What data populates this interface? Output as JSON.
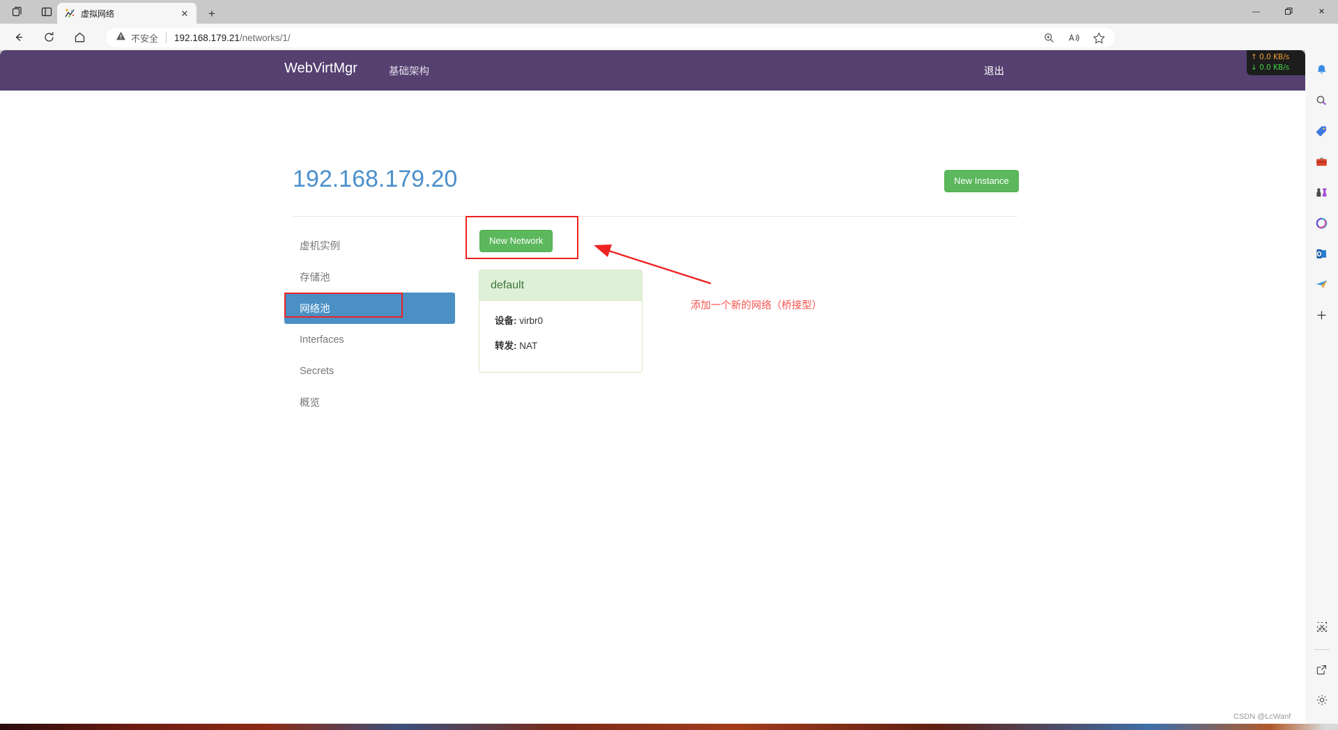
{
  "browser": {
    "tab": {
      "title": "虚拟网络",
      "favicon": "chart-icon",
      "close": "✕"
    },
    "newtab_label": "+",
    "window_controls": {
      "minimize": "—",
      "maximize": "❐",
      "close": "✕"
    },
    "toolbar_left_icons": [
      "tab-groups-icon",
      "split-screen-icon"
    ],
    "nav": {
      "back": "←",
      "refresh": "⟳",
      "home": "⌂"
    },
    "omnibox": {
      "security_label": "不安全",
      "security_icon": "warning-triangle-icon",
      "url_host": "192.168.179.21",
      "url_path": "/networks/1/",
      "actions": [
        "zoom-icon",
        "read-aloud-icon",
        "favorite-star-icon"
      ]
    },
    "toolbar_right_icons": [
      "extensions-puzzle-icon",
      "split-screen-icon",
      "favorites-icon",
      "collections-icon",
      "browser-essentials-icon",
      "profile-avatar-icon",
      "settings-more-icon",
      "copilot-bing-icon"
    ],
    "edgebar_icons": [
      "notification-bell-icon",
      "search-icon",
      "shopping-tag-icon",
      "tools-briefcase-icon",
      "games-icon",
      "microsoft-365-icon",
      "outlook-icon",
      "telegram-send-icon",
      "add-sidebar-app-icon"
    ],
    "edgebar_bottom_icons": [
      "screenshot-scissor-icon",
      "open-in-new-icon",
      "settings-gear-icon"
    ]
  },
  "app": {
    "brand": "WebVirtMgr",
    "nav_link": "基础架构",
    "logout": "退出",
    "netspeed": {
      "up": "↑ 0.0 KB/s",
      "down": "↓ 0.0 KB/s"
    },
    "host_title": "192.168.179.20",
    "new_instance_label": "New Instance",
    "new_network_label": "New Network",
    "sidebar": {
      "items": [
        {
          "label": "虚机实例",
          "active": false
        },
        {
          "label": "存储池",
          "active": false
        },
        {
          "label": "网络池",
          "active": true
        },
        {
          "label": "Interfaces",
          "active": false
        },
        {
          "label": "Secrets",
          "active": false
        },
        {
          "label": "概览",
          "active": false
        }
      ]
    },
    "network_card": {
      "name": "default",
      "rows": [
        {
          "label": "设备:",
          "value": "virbr0"
        },
        {
          "label": "转发:",
          "value": "NAT"
        }
      ]
    }
  },
  "annotations": {
    "note_text": "添加一个新的网络（桥接型）",
    "accent_color": "#ee2222",
    "note_color": "#f4534f"
  },
  "watermark": "CSDN @LcWanf"
}
